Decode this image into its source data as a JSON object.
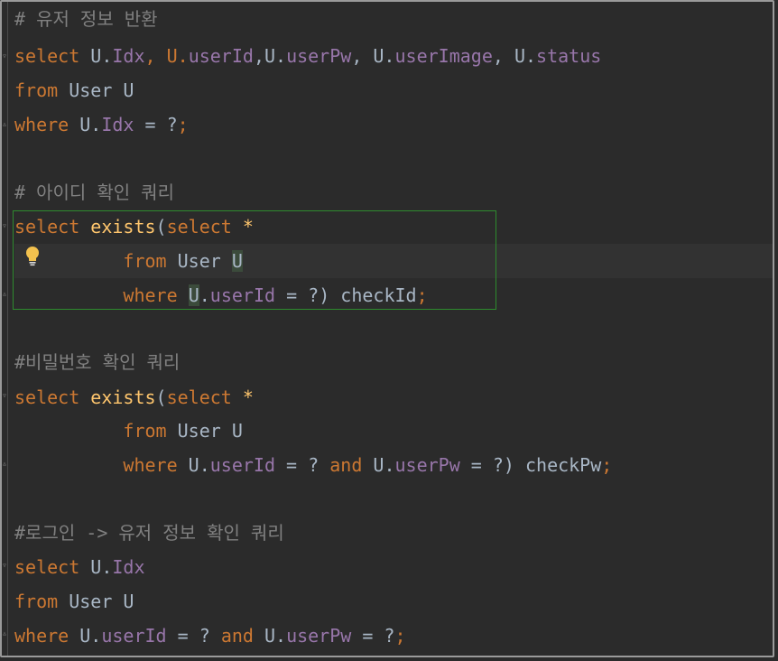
{
  "editor": {
    "lines": {
      "l1": "# 유저 정보 반환",
      "l2": {
        "select": "select",
        "a": "U.",
        "b": "Idx",
        "c": ", U.",
        "d": "userId",
        "e": ",U.",
        "f": "userPw",
        "g": ", U.",
        "h": "userImage",
        "i": ", U.",
        "j": "status"
      },
      "l3": {
        "from": "from",
        "rest": " User U"
      },
      "l4": {
        "where": "where",
        "a": " U.",
        "b": "Idx",
        "c": " = ?",
        "semi": ";"
      },
      "l6": "# 아이디 확인 쿼리",
      "l7": {
        "select": "select",
        "exists": "exists",
        "paren": "(",
        "select2": "select",
        "star": " *"
      },
      "l8": {
        "from": "from",
        "rest": " User ",
        "u": "U"
      },
      "l9": {
        "where": "where",
        "u": "U",
        "a": ".",
        "b": "userId",
        "c": " = ?) checkId",
        "semi": ";"
      },
      "l11": "#비밀번호 확인 쿼리",
      "l12": {
        "select": "select",
        "exists": "exists",
        "paren": "(",
        "select2": "select",
        "star": " *"
      },
      "l13": {
        "from": "from",
        "rest": " User U"
      },
      "l14": {
        "where": "where",
        "a": " U.",
        "b": "userId",
        "c": " = ? ",
        "and": "and",
        "d": " U.",
        "e": "userPw",
        "f": " = ?) checkPw",
        "semi": ";"
      },
      "l16": "#로그인 -> 유저 정보 확인 쿼리",
      "l17": {
        "select": "select",
        "a": " U.",
        "b": "Idx"
      },
      "l18": {
        "from": "from",
        "rest": " User U"
      },
      "l19": {
        "where": "where",
        "a": " U.",
        "b": "userId",
        "c": " = ? ",
        "and": "and",
        "d": " U.",
        "e": "userPw",
        "f": " = ?",
        "semi": ";"
      }
    },
    "icons": {
      "intention": "lightbulb-icon",
      "fold": "fold-marker-icon"
    },
    "colors": {
      "background": "#2b2b2b",
      "keyword": "#cc7832",
      "function": "#ffc66d",
      "field": "#9876aa",
      "comment": "#808080",
      "text": "#a9b7c6",
      "selection_border": "#2e8b2e"
    }
  }
}
